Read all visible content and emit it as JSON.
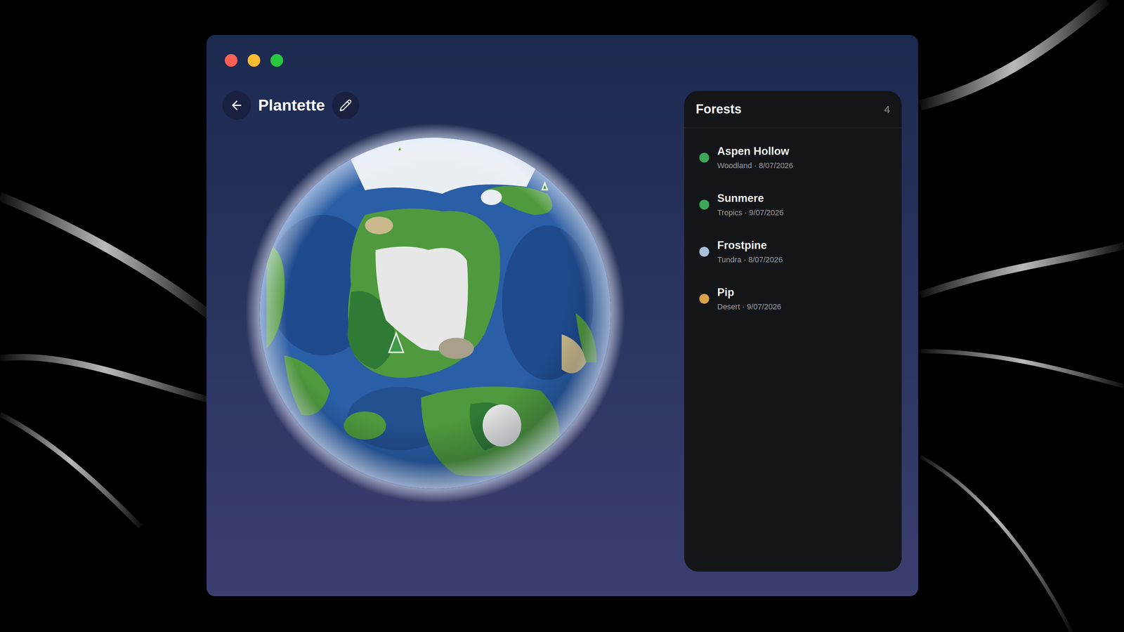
{
  "window": {
    "title": "Plantette"
  },
  "panel": {
    "title": "Forests",
    "count": "4",
    "items": [
      {
        "name": "Aspen Hollow",
        "detail": "Woodland · 8/07/2026",
        "color": "#3ea85a"
      },
      {
        "name": "Sunmere",
        "detail": "Tropics · 9/07/2026",
        "color": "#3ea85a"
      },
      {
        "name": "Frostpine",
        "detail": "Tundra · 8/07/2026",
        "color": "#a9c0da"
      },
      {
        "name": "Pip",
        "detail": "Desert · 9/07/2026",
        "color": "#d9a24a"
      }
    ]
  }
}
